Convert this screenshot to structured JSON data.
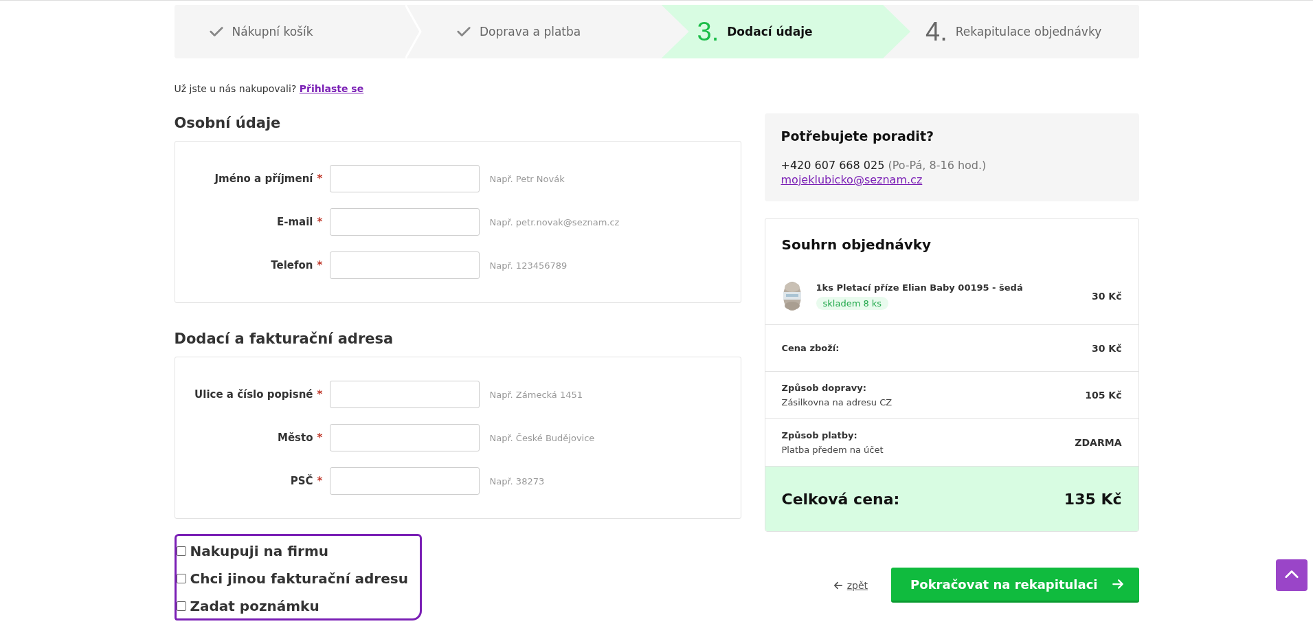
{
  "steps": [
    {
      "label": "Nákupní košík",
      "completed": true,
      "selected": false
    },
    {
      "label": "Doprava a platba",
      "completed": true,
      "selected": false
    },
    {
      "number": "3.",
      "label": "Dodací údaje",
      "completed": false,
      "selected": true
    },
    {
      "number": "4.",
      "label": "Rekapitulace objednávky",
      "completed": false,
      "selected": false
    }
  ],
  "login_prompt": {
    "text": "Už jste u nás nakupovali?",
    "link": "Přihlaste se"
  },
  "sections": [
    {
      "title": "Osobní údaje",
      "fields": [
        {
          "label": "Jméno a příjmení",
          "required_mark": "*",
          "hint": "Např. Petr Novák"
        },
        {
          "label": "E-mail",
          "required_mark": "*",
          "hint": "Např. petr.novak@seznam.cz"
        },
        {
          "label": "Telefon",
          "required_mark": "*",
          "hint": "Např. 123456789"
        }
      ]
    },
    {
      "title": "Dodací a fakturační adresa",
      "fields": [
        {
          "label": "Ulice a číslo popisné",
          "required_mark": "*",
          "hint": "Např. Zámecká 1451"
        },
        {
          "label": "Město",
          "required_mark": "*",
          "hint": "Např. České Budějovice"
        },
        {
          "label": "PSČ",
          "required_mark": "*",
          "hint": "Např. 38273"
        }
      ]
    }
  ],
  "options": [
    {
      "label": "Nakupuji na firmu",
      "checked": false
    },
    {
      "label": "Chci jinou fakturační adresu",
      "checked": false
    },
    {
      "label": "Zadat poznámku",
      "checked": false
    }
  ],
  "help": {
    "title": "Potřebujete poradit?",
    "phone": "+420 607 668 025",
    "hours": "(Po-Pá, 8-16 hod.)",
    "email": "mojeklubicko@seznam.cz"
  },
  "summary": {
    "title": "Souhrn objednávky",
    "item": {
      "name": "1ks Pletací příze Elian Baby 00195 - šedá",
      "stock": "skladem 8 ks",
      "price": "30 Kč"
    },
    "rows": [
      {
        "label": "Cena zboží:",
        "value": "30 Kč"
      },
      {
        "label": "Způsob dopravy:",
        "detail": "Zásilkovna na adresu CZ",
        "value": "105 Kč"
      },
      {
        "label": "Způsob platby:",
        "detail": "Platba předem na účet",
        "value": "ZDARMA"
      }
    ],
    "total_label": "Celková cena:",
    "total_value": "135 Kč"
  },
  "back_link": "zpět",
  "continue_button": "Pokračovat na rekapitulaci"
}
